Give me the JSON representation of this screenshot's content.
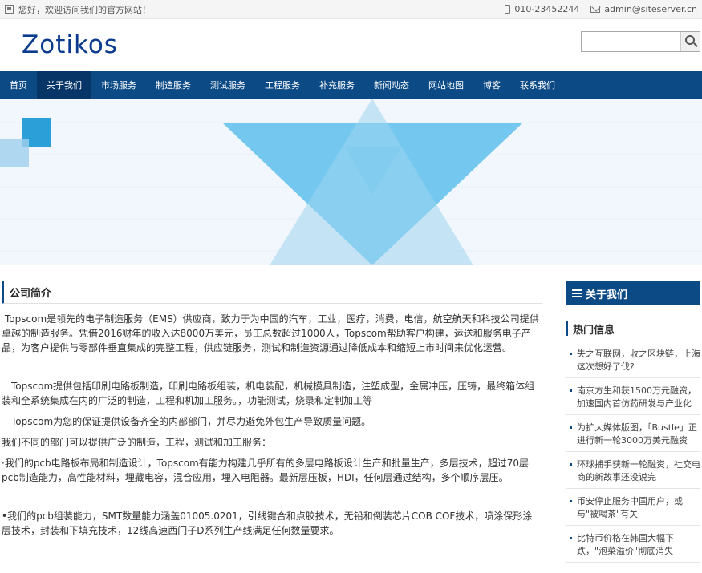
{
  "topbar": {
    "welcome": "您好，欢迎访问我们的官方网站！",
    "phone": "010-23452244",
    "email": "admin@siteserver.cn"
  },
  "header": {
    "logo": "Zotikos",
    "search_placeholder": ""
  },
  "nav": {
    "items": [
      "首页",
      "关于我们",
      "市场服务",
      "制造服务",
      "测试服务",
      "工程服务",
      "补充服务",
      "新闻动态",
      "网站地图",
      "博客",
      "联系我们"
    ],
    "active_index": 1
  },
  "main": {
    "title": "公司简介",
    "paragraphs": [
      "Topscom是领先的电子制造服务（EMS）供应商，致力于为中国的汽车，工业，医疗，消费，电信，航空航天和科技公司提供卓越的制造服务。凭借2016财年的收入达8000万美元，员工总数超过1000人，Topscom帮助客户构建，运送和服务电子产品，为客户提供与零部件垂直集成的完整工程，供应链服务，测试和制造资源通过降低成本和缩短上市时间来优化运营。",
      "Topscom提供包括印刷电路板制造，印刷电路板组装，机电装配，机械模具制造，注塑成型，金属冲压，压铸，最终箱体组装和全系统集成在内的广泛的制造，工程和机加工服务。，功能测试，烧录和定制加工等",
      "Topscom为您的保证提供设备齐全的内部部门，并尽力避免外包生产导致质量问题。",
      "我们不同的部门可以提供广泛的制造，工程，测试和加工服务：",
      "·我们的pcb电路板布局和制造设计，Topscom有能力构建几乎所有的多层电路板设计生产和批量生产，多层技术，超过70层pcb制造能力，高性能材料，埋藏电容，混合应用，埋入电阻器。最新层压板，HDI，任何层通过结构，多个顺序层压。",
      "•我们的pcb组装能力，SMT数量能力涵盖01005.0201，引线键合和点胶技术，无铅和倒装芯片COB COF技术，喷涂保形涂层技术，封装和下填充技术，12线高速西门子D系列生产线满足任何数量要求。"
    ]
  },
  "side": {
    "about_label": "关于我们",
    "hot_title": "热门信息",
    "hot_items": [
      "失之互联网，收之区块链，上海这次想好了伐?",
      "南京方生和获1500万元融资，加速国内首仿药研发与产业化",
      "为扩大媒体版图，「Bustle」正进行新一轮3000万美元融资",
      "环球捕手获新一轮融资，社交电商的新故事还没说完",
      "币安停止服务中国用户，或与\"被喝茶\"有关",
      "比特币价格在韩国大幅下跌，\"泡菜溢价\"彻底消失"
    ]
  },
  "colors": {
    "nav_bg": "#0c4a86",
    "nav_active": "#083567",
    "logo": "#0b3b8c"
  }
}
